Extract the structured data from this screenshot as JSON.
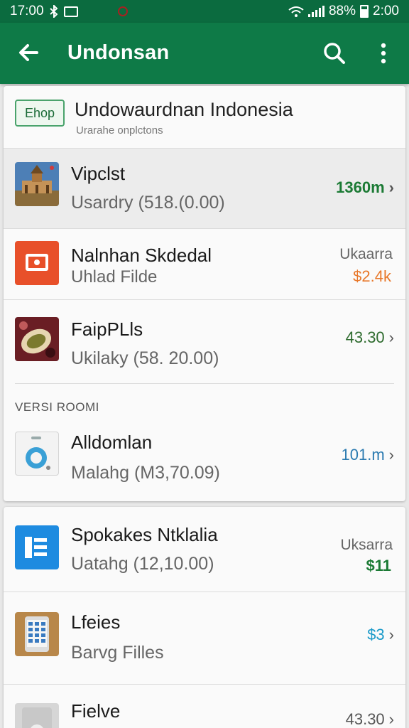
{
  "status_bar": {
    "time_left": "17:00",
    "battery_pct": "88%",
    "time_right": "2:00"
  },
  "app_bar": {
    "title": "Undonsan"
  },
  "header": {
    "chip": "Ehop",
    "title": "Undowaurdnan Indonesia",
    "subtitle": "Urarahe onplctons"
  },
  "rows_group1": [
    {
      "title": "Vipclst",
      "subtitle": "Usardry (518.(0.00)",
      "right": "1360m",
      "right_color": "#1b7a34"
    },
    {
      "title": "Nalnhan Skdedal",
      "subtitle": "Uhlad Filde",
      "right_top": "Ukaarra",
      "right": "$2.4k",
      "right_color": "#e8782a"
    },
    {
      "title": "FaipPLls",
      "subtitle": "Ukilaky (58. 20.00)",
      "right": "43.30",
      "right_color": "#2e6b2e"
    }
  ],
  "section_label": "VERSI ROOMI",
  "rows_group2": [
    {
      "title": "Alldomlan",
      "subtitle": "Malahg (M3,70.09)",
      "right": "101.m",
      "right_color": "#2a7ab0"
    }
  ],
  "rows_card2": [
    {
      "title": "Spokakes Ntklalia",
      "subtitle": "Uatahg (12,10.00)",
      "right_top": "Uksarra",
      "right": "$11",
      "right_color": "#1b7a34"
    },
    {
      "title": "Lfeies",
      "subtitle": "Barvg Filles",
      "right": "$3",
      "right_color": "#1a9ac9"
    },
    {
      "title": "Fielve",
      "subtitle": "",
      "right": "43.30",
      "right_color": "#555555"
    }
  ],
  "icons": {
    "back": "arrow-left",
    "search": "magnifier",
    "more": "vertical-dots",
    "thumb1": "temple-photo",
    "thumb2": "screen-cast",
    "thumb3": "coffee-photo",
    "thumb4": "washing-machine",
    "thumb5": "document-list",
    "thumb6": "phone-calculator",
    "thumb7": "device-grey"
  }
}
